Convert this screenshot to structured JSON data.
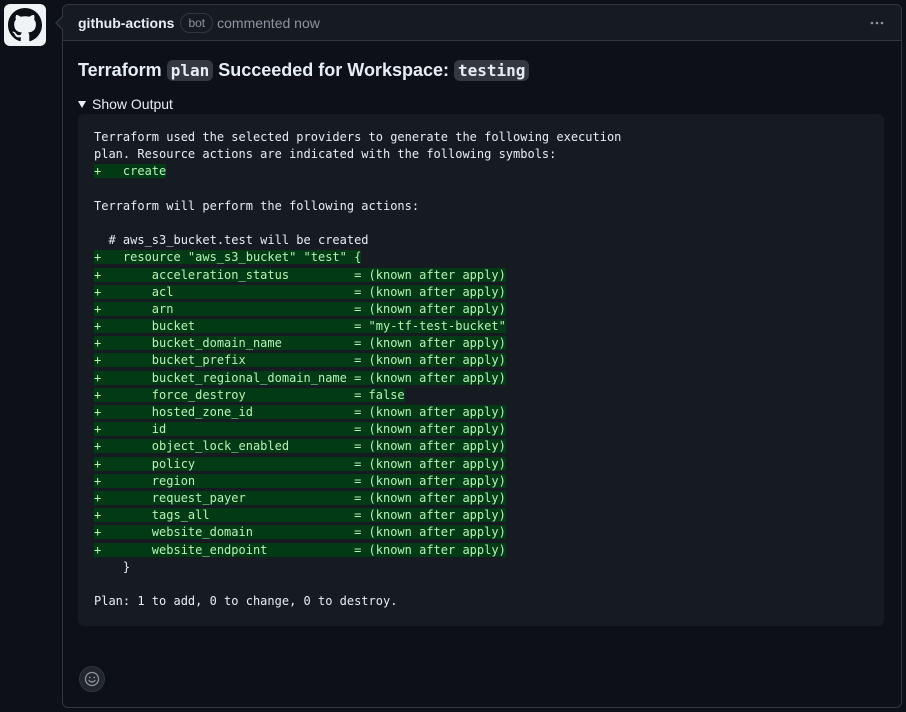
{
  "avatar": {
    "icon": "github-mark-icon"
  },
  "header": {
    "author": "github-actions",
    "badge": "bot",
    "meta": "commented now",
    "menu_icon": "kebab-horizontal-icon"
  },
  "title": {
    "part1": "Terraform ",
    "code1": "plan",
    "part2": " Succeeded for Workspace: ",
    "code2": "testing"
  },
  "details": {
    "summary": "Show Output"
  },
  "output": {
    "lines": [
      {
        "text": "Terraform used the selected providers to generate the following execution",
        "added": false
      },
      {
        "text": "plan. Resource actions are indicated with the following symbols:",
        "added": false
      },
      {
        "text": "+   create",
        "added": true
      },
      {
        "text": "",
        "added": false
      },
      {
        "text": "Terraform will perform the following actions:",
        "added": false
      },
      {
        "text": "",
        "added": false
      },
      {
        "text": "  # aws_s3_bucket.test will be created",
        "added": false
      },
      {
        "text": "+   resource \"aws_s3_bucket\" \"test\" {",
        "added": true
      },
      {
        "text": "+       acceleration_status         = (known after apply)",
        "added": true
      },
      {
        "text": "+       acl                         = (known after apply)",
        "added": true
      },
      {
        "text": "+       arn                         = (known after apply)",
        "added": true
      },
      {
        "text": "+       bucket                      = \"my-tf-test-bucket\"",
        "added": true
      },
      {
        "text": "+       bucket_domain_name          = (known after apply)",
        "added": true
      },
      {
        "text": "+       bucket_prefix               = (known after apply)",
        "added": true
      },
      {
        "text": "+       bucket_regional_domain_name = (known after apply)",
        "added": true
      },
      {
        "text": "+       force_destroy               = false",
        "added": true
      },
      {
        "text": "+       hosted_zone_id              = (known after apply)",
        "added": true
      },
      {
        "text": "+       id                          = (known after apply)",
        "added": true
      },
      {
        "text": "+       object_lock_enabled         = (known after apply)",
        "added": true
      },
      {
        "text": "+       policy                      = (known after apply)",
        "added": true
      },
      {
        "text": "+       region                      = (known after apply)",
        "added": true
      },
      {
        "text": "+       request_payer               = (known after apply)",
        "added": true
      },
      {
        "text": "+       tags_all                    = (known after apply)",
        "added": true
      },
      {
        "text": "+       website_domain              = (known after apply)",
        "added": true
      },
      {
        "text": "+       website_endpoint            = (known after apply)",
        "added": true
      },
      {
        "text": "    }",
        "added": false
      },
      {
        "text": "",
        "added": false
      },
      {
        "text": "Plan: 1 to add, 0 to change, 0 to destroy.",
        "added": false
      }
    ]
  },
  "reactions": {
    "icon": "smiley-icon"
  },
  "colors": {
    "background": "#0d1117",
    "header_bg": "#161b22",
    "border": "#30363d",
    "added_bg": "#033a16",
    "added_fg": "#aff5b4",
    "muted": "#8b949e"
  }
}
